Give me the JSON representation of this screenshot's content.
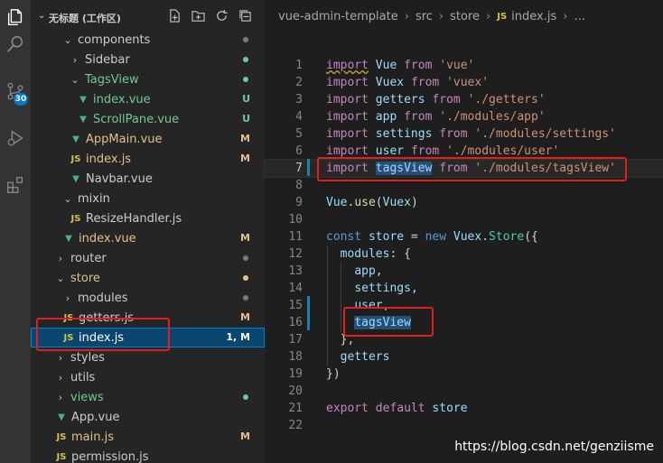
{
  "activity_bar": {
    "items": [
      {
        "icon": "files-icon"
      },
      {
        "icon": "search-icon"
      },
      {
        "icon": "source-control-icon"
      },
      {
        "icon": "run-debug-icon"
      },
      {
        "icon": "extensions-icon"
      }
    ],
    "scm_badge": "30"
  },
  "sidebar": {
    "title": "无标题 (工作区)",
    "actions": [
      "new-file-icon",
      "new-folder-icon",
      "refresh-icon",
      "collapse-all-icon"
    ],
    "items": [
      {
        "label": "components",
        "kind": "folder",
        "chevron": "⌄",
        "depth": 2,
        "color": "#cccccc",
        "status_dot": "#7a7a7a"
      },
      {
        "label": "Sidebar",
        "kind": "folder",
        "chevron": "›",
        "depth": 3,
        "color": "#cccccc",
        "status_dot": "#73c991"
      },
      {
        "label": "TagsView",
        "kind": "folder",
        "chevron": "⌄",
        "depth": 3,
        "color": "#73c991",
        "status_dot": "#73c991"
      },
      {
        "label": "index.vue",
        "kind": "vue",
        "depth": 4,
        "color": "#73c991",
        "status": "U",
        "status_color": "#73c991"
      },
      {
        "label": "ScrollPane.vue",
        "kind": "vue",
        "depth": 4,
        "color": "#73c991",
        "status": "U",
        "status_color": "#73c991"
      },
      {
        "label": "AppMain.vue",
        "kind": "vue",
        "depth": 3,
        "color": "#e2c08d",
        "status": "M",
        "status_color": "#e2c08d"
      },
      {
        "label": "index.js",
        "kind": "js",
        "depth": 3,
        "color": "#e2c08d",
        "status": "M",
        "status_color": "#e2c08d"
      },
      {
        "label": "Navbar.vue",
        "kind": "vue",
        "depth": 3,
        "color": "#cccccc"
      },
      {
        "label": "mixin",
        "kind": "folder",
        "chevron": "⌄",
        "depth": 2,
        "color": "#cccccc"
      },
      {
        "label": "ResizeHandler.js",
        "kind": "js",
        "depth": 3,
        "color": "#cccccc"
      },
      {
        "label": "index.vue",
        "kind": "vue",
        "depth": 2,
        "color": "#e2c08d",
        "status": "M",
        "status_color": "#e2c08d"
      },
      {
        "label": "router",
        "kind": "folder",
        "chevron": "›",
        "depth": 1,
        "color": "#cccccc",
        "status_dot": "#7a7a7a"
      },
      {
        "label": "store",
        "kind": "folder",
        "chevron": "⌄",
        "depth": 1,
        "color": "#e2c08d",
        "status_dot": "#e2c08d"
      },
      {
        "label": "modules",
        "kind": "folder",
        "chevron": "›",
        "depth": 2,
        "color": "#cccccc",
        "status_dot": "#7a7a7a"
      },
      {
        "label": "getters.js",
        "kind": "js",
        "depth": 2,
        "color": "#cccccc",
        "status": "M",
        "status_color": "#e2c08d"
      },
      {
        "label": "index.js",
        "kind": "js",
        "depth": 2,
        "color": "#e2c08d",
        "status": "1, M",
        "status_color": "#e2c08d",
        "selected": true
      },
      {
        "label": "styles",
        "kind": "folder",
        "chevron": "›",
        "depth": 1,
        "color": "#cccccc"
      },
      {
        "label": "utils",
        "kind": "folder",
        "chevron": "›",
        "depth": 1,
        "color": "#cccccc"
      },
      {
        "label": "views",
        "kind": "folder",
        "chevron": "›",
        "depth": 1,
        "color": "#73c991",
        "status_dot": "#73c991"
      },
      {
        "label": "App.vue",
        "kind": "vue",
        "depth": 1,
        "color": "#cccccc"
      },
      {
        "label": "main.js",
        "kind": "js",
        "depth": 1,
        "color": "#e2c08d",
        "status": "M",
        "status_color": "#e2c08d"
      },
      {
        "label": "permission.js",
        "kind": "js",
        "depth": 1,
        "color": "#cccccc"
      }
    ]
  },
  "breadcrumb": {
    "parts": [
      "vue-admin-template",
      "src",
      "store"
    ],
    "file_icon": "JS",
    "file": "index.js",
    "more": "..."
  },
  "editor": {
    "lines": [
      {
        "n": "1",
        "tokens": [
          [
            "kw",
            "import"
          ],
          [
            "plain",
            " "
          ],
          [
            "var",
            "Vue"
          ],
          [
            "plain",
            " "
          ],
          [
            "kw",
            "from"
          ],
          [
            "plain",
            " "
          ],
          [
            "str",
            "'vue'"
          ]
        ]
      },
      {
        "n": "2",
        "tokens": [
          [
            "kw",
            "import"
          ],
          [
            "plain",
            " "
          ],
          [
            "var",
            "Vuex"
          ],
          [
            "plain",
            " "
          ],
          [
            "kw",
            "from"
          ],
          [
            "plain",
            " "
          ],
          [
            "str",
            "'vuex'"
          ]
        ]
      },
      {
        "n": "3",
        "tokens": [
          [
            "kw",
            "import"
          ],
          [
            "plain",
            " "
          ],
          [
            "var",
            "getters"
          ],
          [
            "plain",
            " "
          ],
          [
            "kw",
            "from"
          ],
          [
            "plain",
            " "
          ],
          [
            "str",
            "'./getters'"
          ]
        ]
      },
      {
        "n": "4",
        "tokens": [
          [
            "kw",
            "import"
          ],
          [
            "plain",
            " "
          ],
          [
            "var",
            "app"
          ],
          [
            "plain",
            " "
          ],
          [
            "kw",
            "from"
          ],
          [
            "plain",
            " "
          ],
          [
            "str",
            "'./modules/app'"
          ]
        ]
      },
      {
        "n": "5",
        "tokens": [
          [
            "kw",
            "import"
          ],
          [
            "plain",
            " "
          ],
          [
            "var",
            "settings"
          ],
          [
            "plain",
            " "
          ],
          [
            "kw",
            "from"
          ],
          [
            "plain",
            " "
          ],
          [
            "str",
            "'./modules/settings'"
          ]
        ]
      },
      {
        "n": "6",
        "tokens": [
          [
            "kw",
            "import"
          ],
          [
            "plain",
            " "
          ],
          [
            "var",
            "user"
          ],
          [
            "plain",
            " "
          ],
          [
            "kw",
            "from"
          ],
          [
            "plain",
            " "
          ],
          [
            "str",
            "'./modules/user'"
          ]
        ]
      },
      {
        "n": "7",
        "current": true,
        "tokens": [
          [
            "kw",
            "import"
          ],
          [
            "plain",
            " "
          ],
          [
            "var hl",
            "tagsView"
          ],
          [
            "plain",
            " "
          ],
          [
            "kw",
            "from"
          ],
          [
            "plain",
            " "
          ],
          [
            "str",
            "'./modules/tagsView'"
          ]
        ]
      },
      {
        "n": "8",
        "tokens": []
      },
      {
        "n": "9",
        "tokens": [
          [
            "var",
            "Vue"
          ],
          [
            "plain",
            "."
          ],
          [
            "fn",
            "use"
          ],
          [
            "plain",
            "("
          ],
          [
            "var",
            "Vuex"
          ],
          [
            "plain",
            ")"
          ]
        ]
      },
      {
        "n": "10",
        "tokens": []
      },
      {
        "n": "11",
        "tokens": [
          [
            "kw2",
            "const"
          ],
          [
            "plain",
            " "
          ],
          [
            "var",
            "store"
          ],
          [
            "plain",
            " = "
          ],
          [
            "kw2",
            "new"
          ],
          [
            "plain",
            " "
          ],
          [
            "var",
            "Vuex"
          ],
          [
            "plain",
            "."
          ],
          [
            "cls",
            "Store"
          ],
          [
            "plain",
            "({"
          ]
        ]
      },
      {
        "n": "12",
        "tokens": [
          [
            "plain",
            "  "
          ],
          [
            "var",
            "modules"
          ],
          [
            "plain",
            ": {"
          ]
        ]
      },
      {
        "n": "13",
        "tokens": [
          [
            "plain",
            "    "
          ],
          [
            "var",
            "app"
          ],
          [
            "plain",
            ","
          ]
        ]
      },
      {
        "n": "14",
        "tokens": [
          [
            "plain",
            "    "
          ],
          [
            "var",
            "settings"
          ],
          [
            "plain",
            ","
          ]
        ]
      },
      {
        "n": "15",
        "tokens": [
          [
            "plain",
            "    "
          ],
          [
            "var",
            "user"
          ],
          [
            "plain",
            ","
          ]
        ]
      },
      {
        "n": "16",
        "tokens": [
          [
            "plain",
            "    "
          ],
          [
            "var hl",
            "tagsView"
          ]
        ]
      },
      {
        "n": "17",
        "tokens": [
          [
            "plain",
            "  },"
          ]
        ]
      },
      {
        "n": "18",
        "tokens": [
          [
            "plain",
            "  "
          ],
          [
            "var",
            "getters"
          ]
        ]
      },
      {
        "n": "19",
        "tokens": [
          [
            "plain",
            "})"
          ]
        ]
      },
      {
        "n": "20",
        "tokens": []
      },
      {
        "n": "21",
        "tokens": [
          [
            "kw",
            "export"
          ],
          [
            "plain",
            " "
          ],
          [
            "kw",
            "default"
          ],
          [
            "plain",
            " "
          ],
          [
            "var",
            "store"
          ]
        ]
      },
      {
        "n": "22",
        "tokens": []
      }
    ]
  },
  "watermark": "https://blog.csdn.net/genziisme",
  "colors": {
    "accent": "#007acc",
    "annotation_red": "#e02020",
    "modified": "#e2c08d",
    "untracked": "#73c991"
  }
}
